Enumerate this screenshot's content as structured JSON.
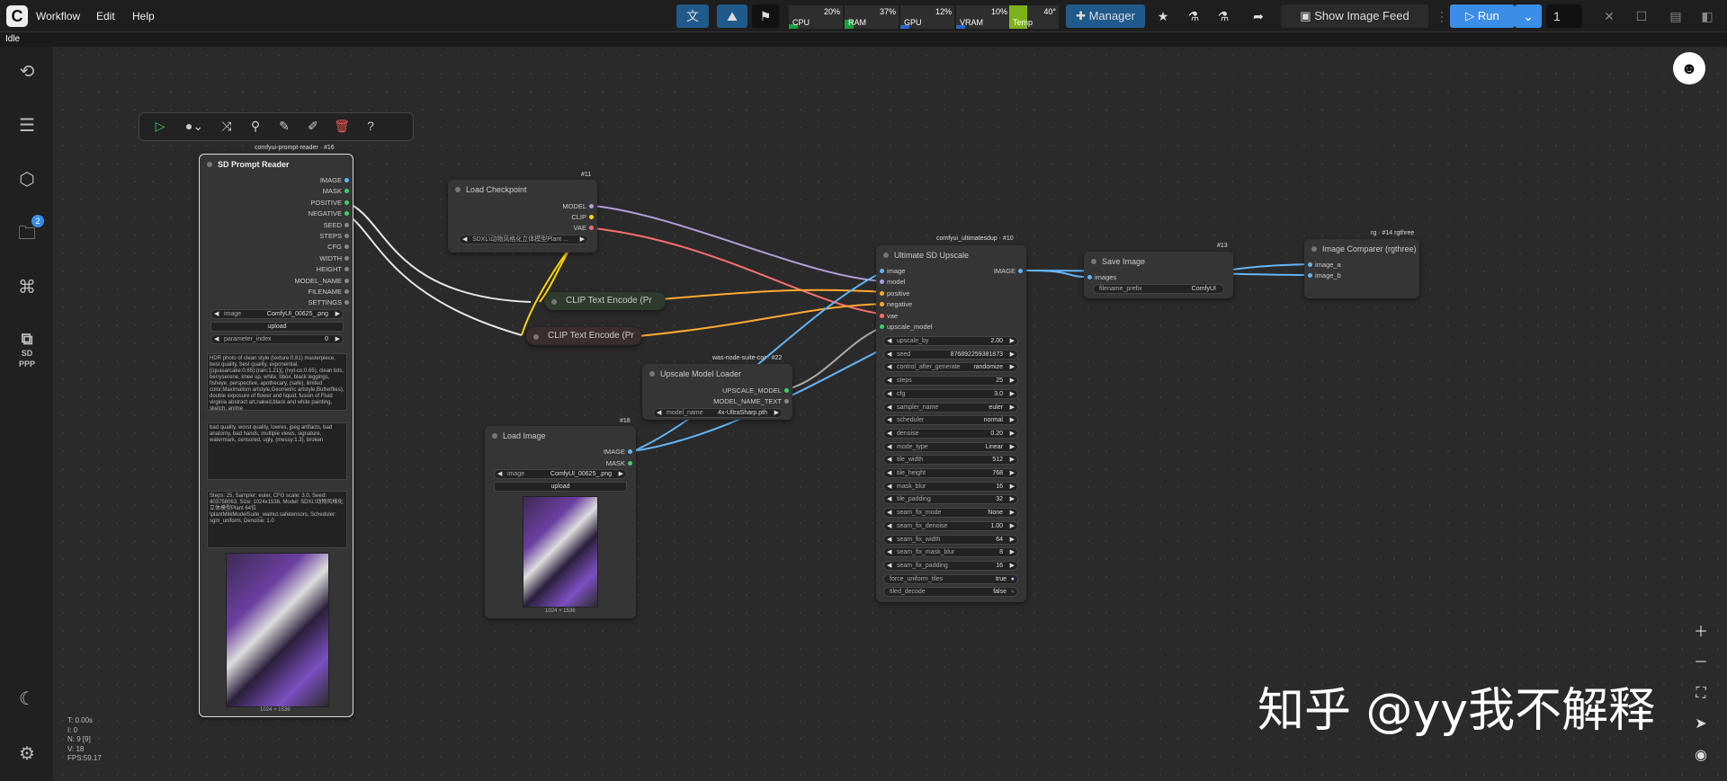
{
  "menu": [
    "Workflow",
    "Edit",
    "Help"
  ],
  "monitors": [
    {
      "label": "CPU",
      "value": "20%",
      "level": 0.2
    },
    {
      "label": "RAM",
      "value": "37%",
      "level": 0.37
    },
    {
      "label": "GPU",
      "value": "12%",
      "level": 0.12
    },
    {
      "label": "VRAM",
      "value": "10%",
      "level": 0.1
    },
    {
      "label": "Temp",
      "value": "40°",
      "level": 0.4
    }
  ],
  "toolbar": {
    "manager_label": "Manager",
    "image_feed_label": "Show Image Feed",
    "run_label": "Run",
    "batch_count": "1"
  },
  "status": "Idle",
  "sidebar": {
    "badge_count": "2",
    "logo_text": "SD PPP"
  },
  "nodes": {
    "prompt_reader": {
      "badge": "comfyui-prompt-reader · #16",
      "title": "SD Prompt Reader",
      "outputs": [
        "IMAGE",
        "MASK",
        "POSITIVE",
        "NEGATIVE",
        "SEED",
        "STEPS",
        "CFG",
        "WIDTH",
        "HEIGHT",
        "MODEL_NAME",
        "FILENAME",
        "SETTINGS"
      ],
      "image_label": "image",
      "image_value": "ComfyUI_00625_.png",
      "upload": "upload",
      "param_label": "parameter_index",
      "param_value": "0",
      "positive_text": "HDR photo of clean style (texture:0.81) masterpiece, best quality, best quality, exponential, [(quasarcake:0.65):(rain:1.21)], (ivyt-co:0.65), clean bits, berryserene, knee up, white, bbox, black leggings, fisheye, perspective, apothecary, (safe), limited color,Maximalism artstyle,Geometric artstyle,Butterflies), double exposure of flower and liquid, fusion of Fluid virginia abstract art,naked,black and white painting, sketch, anime",
      "negative_text": "bad quality, worst quality, lowres, jpeg artifacts, bad anatomy, bad hands, multiple views, signature, watermark, censored, ugly, (messy:1.3), broken",
      "settings_text": "Steps: 25, Sampler: euler, CFG scale: 3.0, Seed: 403758063, Size: 1024x1536, Model: SDXL\\动物风格化立体模型Plant 64位\\plantMilkModelSuite_walnut.safetensors, Scheduler: sgm_uniform, Denoise: 1.0",
      "image_caption": "1024 × 1536"
    },
    "load_checkpoint": {
      "badge": "#11",
      "title": "Load Checkpoint",
      "outputs": [
        "MODEL",
        "CLIP",
        "VAE"
      ],
      "ckpt_value": "SDXL\\动物风格化立体模型Plant ..."
    },
    "clip1": {
      "title": "CLIP Text Encode (Pr"
    },
    "clip2": {
      "title": "CLIP Text Encode (Pr"
    },
    "upscale_loader": {
      "badge": "was-node-suite-cor · #22",
      "title": "Upscale Model Loader",
      "outputs": [
        "UPSCALE_MODEL",
        "MODEL_NAME_TEXT"
      ],
      "model_label": "model_name",
      "model_value": "4x-UltraSharp.pth"
    },
    "load_image": {
      "badge": "#18",
      "title": "Load Image",
      "outputs": [
        "IMAGE",
        "MASK"
      ],
      "image_label": "image",
      "image_value": "ComfyUI_00625_.png",
      "upload": "upload",
      "image_caption": "1024 × 1536"
    },
    "ultimate": {
      "badge": "comfyui_ultimatesdup · #10",
      "title": "Ultimate SD Upscale",
      "inputs": [
        "image",
        "model",
        "positive",
        "negative",
        "vae",
        "upscale_model"
      ],
      "output": "IMAGE",
      "widgets": [
        {
          "label": "upscale_by",
          "value": "2.00"
        },
        {
          "label": "seed",
          "value": "876892259381873"
        },
        {
          "label": "control_after_generate",
          "value": "randomize"
        },
        {
          "label": "steps",
          "value": "25"
        },
        {
          "label": "cfg",
          "value": "3.0"
        },
        {
          "label": "sampler_name",
          "value": "euler"
        },
        {
          "label": "scheduler",
          "value": "normal"
        },
        {
          "label": "denoise",
          "value": "0.20"
        },
        {
          "label": "mode_type",
          "value": "Linear"
        },
        {
          "label": "tile_width",
          "value": "512"
        },
        {
          "label": "tile_height",
          "value": "768"
        },
        {
          "label": "mask_blur",
          "value": "16"
        },
        {
          "label": "tile_padding",
          "value": "32"
        },
        {
          "label": "seam_fix_mode",
          "value": "None"
        },
        {
          "label": "seam_fix_denoise",
          "value": "1.00"
        },
        {
          "label": "seam_fix_width",
          "value": "64"
        },
        {
          "label": "seam_fix_mask_blur",
          "value": "8"
        },
        {
          "label": "seam_fix_padding",
          "value": "16"
        },
        {
          "label": "force_uniform_tiles",
          "value": "true"
        },
        {
          "label": "tiled_decode",
          "value": "false"
        }
      ]
    },
    "save_image": {
      "badge": "#13",
      "title": "Save Image",
      "input": "images",
      "prefix_label": "filename_prefix",
      "prefix_value": "ComfyUI"
    },
    "comparer": {
      "badge": "rg · #14 rgthree",
      "title": "Image Comparer (rgthree)",
      "inputs": [
        "image_a",
        "image_b"
      ]
    }
  },
  "stats": [
    "T: 0.00s",
    "I: 0",
    "N: 9 [9]",
    "V: 18",
    "FPS:59.17"
  ],
  "watermark": "知乎 @yy我不解释",
  "colors": {
    "model": "#b39ddb",
    "clip": "#ffd500",
    "vae": "#ff6e6e",
    "conditioning": "#ffa931",
    "image": "#64b5f6",
    "upscale": "#aaaaaa"
  }
}
